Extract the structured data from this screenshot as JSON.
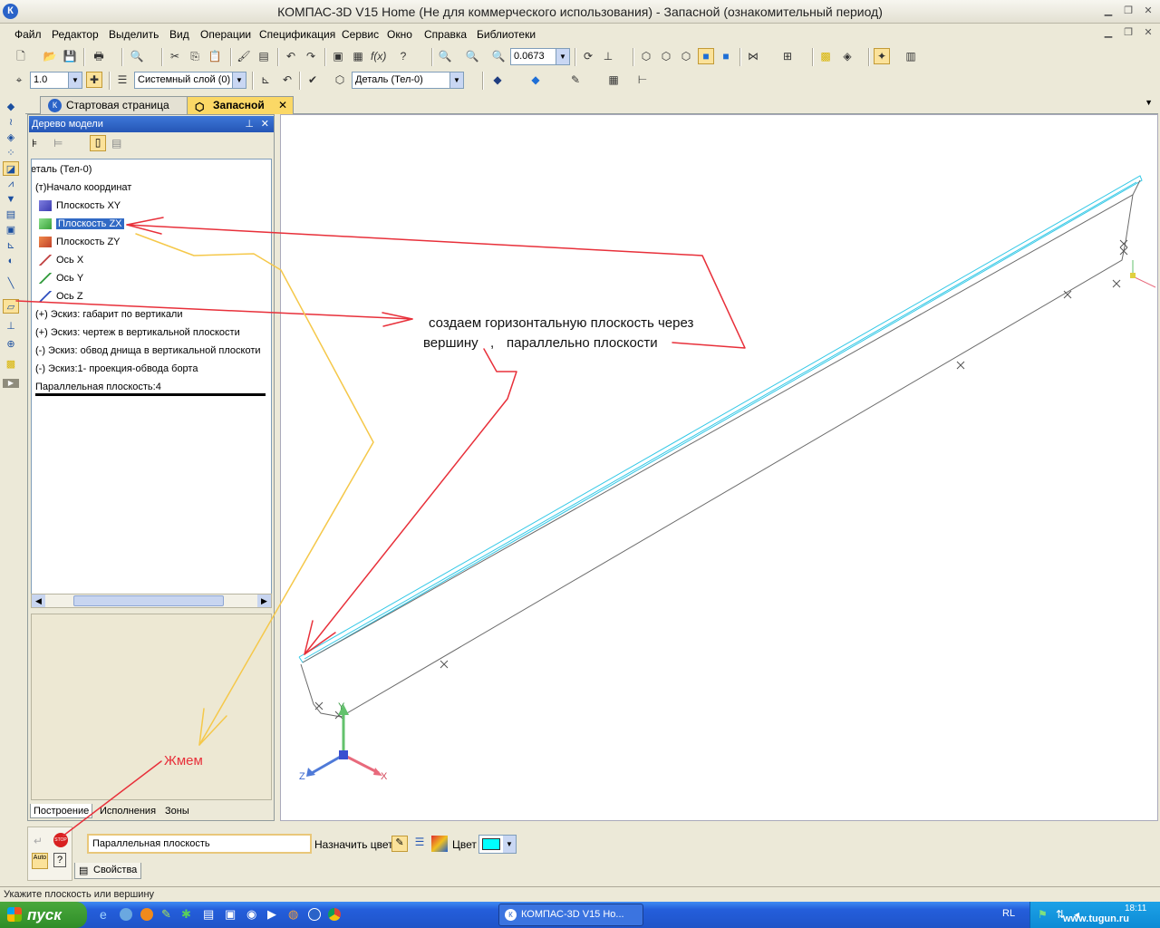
{
  "window": {
    "title": "КОМПАС-3D V15 Home (Не для коммерческого использования) - Запасной (ознакомительный период)",
    "app_icon": "К"
  },
  "menu": [
    "Файл",
    "Редактор",
    "Выделить",
    "Вид",
    "Операции",
    "Спецификация",
    "Сервис",
    "Окно",
    "Справка",
    "Библиотеки"
  ],
  "toolbar": {
    "zoom_value": "0.0673",
    "step_value": "1.0",
    "layer_value": "Системный слой (0)",
    "part_value": "Деталь (Тел-0)"
  },
  "tabs": [
    {
      "label": "Стартовая страница",
      "active": false
    },
    {
      "label": "Запасной",
      "active": true
    }
  ],
  "tree_panel": {
    "title": "Дерево модели",
    "root": "еталь (Тел-0)",
    "items": [
      {
        "label": "(т)Начало координат",
        "indent": 1,
        "icon": "origin-icon",
        "selected": false
      },
      {
        "label": "Плоскость XY",
        "indent": 2,
        "icon": "plane-xy-icon",
        "selected": false
      },
      {
        "label": "Плоскость ZX",
        "indent": 2,
        "icon": "plane-zx-icon",
        "selected": true
      },
      {
        "label": "Плоскость ZY",
        "indent": 2,
        "icon": "plane-zy-icon",
        "selected": false
      },
      {
        "label": "Ось X",
        "indent": 2,
        "icon": "axis-x-icon",
        "selected": false
      },
      {
        "label": "Ось Y",
        "indent": 2,
        "icon": "axis-y-icon",
        "selected": false
      },
      {
        "label": "Ось Z",
        "indent": 2,
        "icon": "axis-z-icon",
        "selected": false
      },
      {
        "label": "(+) Эскиз: габарит по вертикали",
        "indent": 1,
        "icon": "sketch-icon",
        "selected": false
      },
      {
        "label": "(+) Эскиз: чертеж в вертикальной плоскости",
        "indent": 1,
        "icon": "sketch-icon",
        "selected": false
      },
      {
        "label": "(-) Эскиз: обвод днища в вертикальной плоскоти",
        "indent": 1,
        "icon": "sketch-icon",
        "selected": false
      },
      {
        "label": "(-) Эскиз:1- проекция-обвода борта",
        "indent": 1,
        "icon": "sketch-icon",
        "selected": false
      },
      {
        "label": "Параллельная плоскость:4",
        "indent": 1,
        "icon": "plane-icon",
        "selected": false
      }
    ],
    "bottom_tabs": [
      "Построение",
      "Исполнения",
      "Зоны"
    ]
  },
  "annotations": {
    "main_line1": "создаем горизонтальную плоскость  через",
    "main_line2": "вершину",
    "main_line2b": ",",
    "main_line2c": "параллельно плоскости",
    "press": "Жмем"
  },
  "axes": {
    "x": "X",
    "y": "Y",
    "z": "Z"
  },
  "property_bar": {
    "input_value": "Параллельная плоскость",
    "assign_color_label": "Назначить цвет",
    "color_label": "Цвет",
    "color_value": "#00ffff",
    "properties_tab": "Свойства",
    "auto_label": "Auto",
    "stop_label": "STOP"
  },
  "status": "Укажите плоскость или вершину",
  "taskbar": {
    "start_label": "пуск",
    "task_label": "КОМПАС-3D V15 Ho...",
    "lang": "RL",
    "clock": "18:11",
    "watermark": "www.tugun.ru"
  },
  "colors": {
    "annot_red": "#e8303a",
    "annot_yellow": "#f5c84a",
    "model_cyan": "#32c8e6",
    "model_gray": "#6b6b6b"
  }
}
